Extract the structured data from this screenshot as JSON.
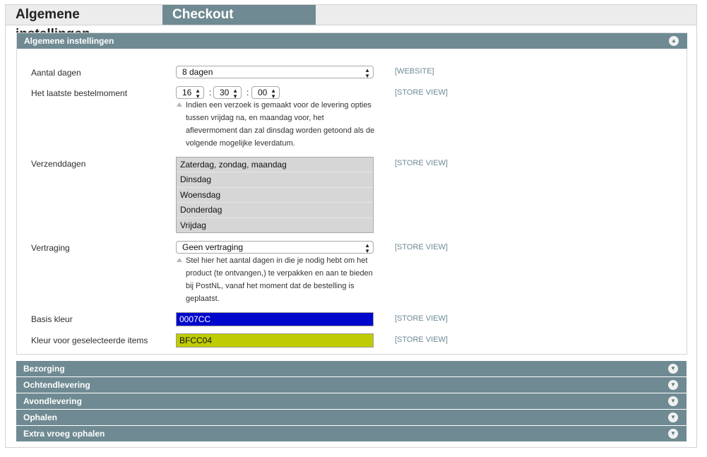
{
  "tabs": [
    {
      "label": "Algemene instellingen",
      "active": false
    },
    {
      "label": "Checkout instellingen",
      "active": true
    }
  ],
  "section_main": {
    "title": "Algemene instellingen",
    "toggle_icon": "chevron-up-icon"
  },
  "fields": {
    "aantal_dagen": {
      "label": "Aantal dagen",
      "value": "8 dagen",
      "scope": "[WEBSITE]"
    },
    "laatste_bestelmoment": {
      "label": "Het laatste bestelmoment",
      "hour": "16",
      "minute": "30",
      "second": "00",
      "separator": ":",
      "scope": "[STORE VIEW]",
      "hint": [
        "Indien een verzoek is gemaakt voor de levering opties",
        "tussen vrijdag na, en maandag voor, het",
        "aflevermoment dan zal dinsdag worden getoond als de",
        "volgende mogelijke leverdatum."
      ]
    },
    "verzenddagen": {
      "label": "Verzenddagen",
      "options": [
        "Zaterdag, zondag, maandag",
        "Dinsdag",
        "Woensdag",
        "Donderdag",
        "Vrijdag"
      ],
      "scope": "[STORE VIEW]"
    },
    "vertraging": {
      "label": "Vertraging",
      "value": "Geen vertraging",
      "scope": "[STORE VIEW]",
      "hint": [
        "Stel hier het aantal dagen in die je nodig hebt om het",
        "product (te ontvangen,) te verpakken en aan te bieden",
        "bij PostNL, vanaf het moment dat de bestelling is",
        "geplaatst."
      ]
    },
    "basis_kleur": {
      "label": "Basis kleur",
      "value": "0007CC",
      "color": "#0007CC",
      "text_color": "#ffffff",
      "scope": "[STORE VIEW]"
    },
    "kleur_geselecteerd": {
      "label": "Kleur voor geselecteerde items",
      "value": "BFCC04",
      "color": "#BFCC04",
      "text_color": "#111111",
      "scope": "[STORE VIEW]"
    }
  },
  "collapsed_sections": [
    {
      "title": "Bezorging",
      "toggle_icon": "chevron-down-icon"
    },
    {
      "title": "Ochtendlevering",
      "toggle_icon": "chevron-down-icon"
    },
    {
      "title": "Avondlevering",
      "toggle_icon": "chevron-down-icon"
    },
    {
      "title": "Ophalen",
      "toggle_icon": "chevron-down-icon"
    },
    {
      "title": "Extra vroeg ophalen",
      "toggle_icon": "chevron-down-icon"
    }
  ],
  "colors": {
    "header_bg": "#6f8a92",
    "scope_text": "#6c8a95"
  }
}
